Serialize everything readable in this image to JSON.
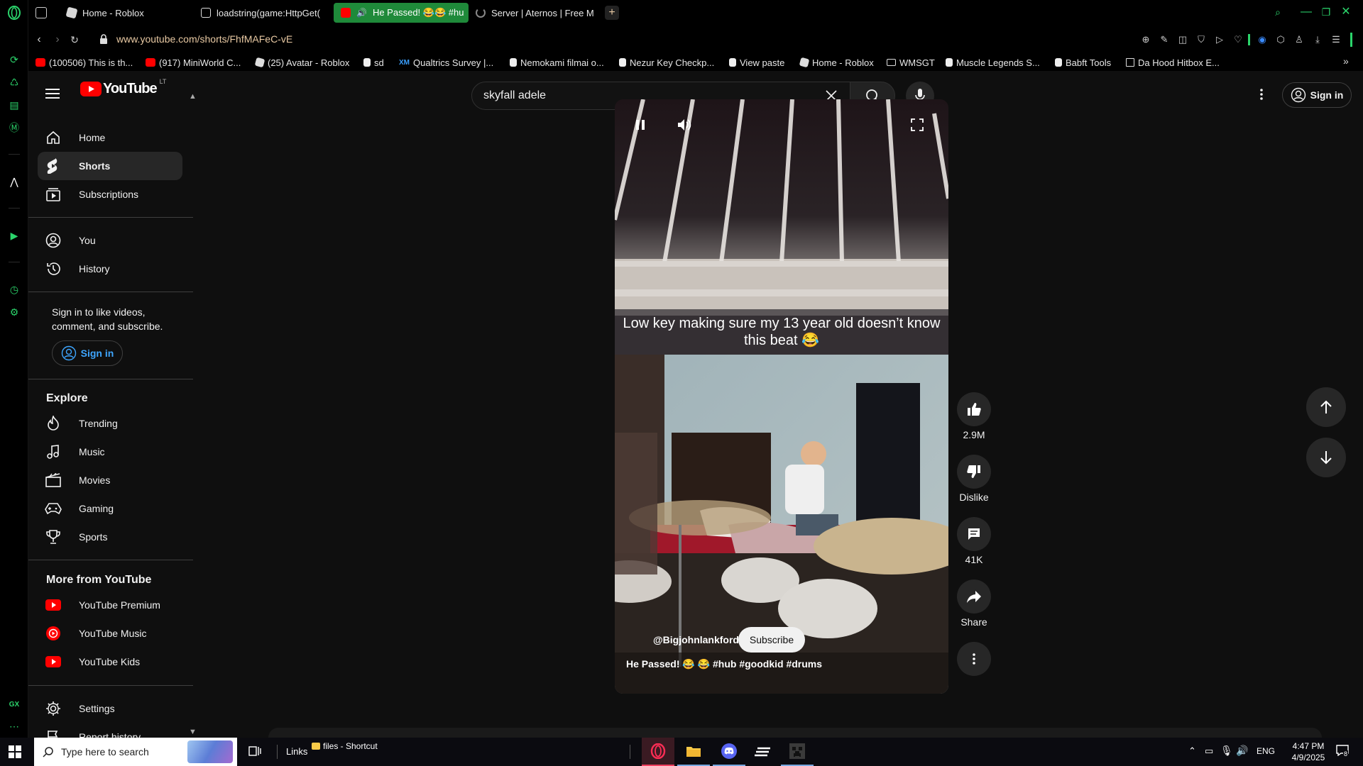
{
  "browser": {
    "tabs": [
      {
        "label": "Home - Roblox",
        "color": "#e0e0e0"
      },
      {
        "label": "loadstring(game:HttpGet(",
        "color": "#e0e0e0"
      },
      {
        "label": "He Passed! 😂😂 #hu",
        "color": "#ff0000"
      },
      {
        "label": "Server | Aternos | Free M",
        "color": "#888888"
      }
    ],
    "url": "www.youtube.com/shorts/FhfMAFeC-vE",
    "accent": "#2bd46b",
    "bookmarks": [
      {
        "label": "(100506) This is th...",
        "icon": "youtube"
      },
      {
        "label": "(917) MiniWorld C...",
        "icon": "youtube"
      },
      {
        "label": "(25) Avatar - Roblox",
        "icon": "roblox"
      },
      {
        "label": "sd",
        "icon": "page"
      },
      {
        "label": "Qualtrics Survey |...",
        "icon": "xm"
      },
      {
        "label": "Nemokami filmai o...",
        "icon": "page"
      },
      {
        "label": "Nezur Key Checkp...",
        "icon": "page"
      },
      {
        "label": "View paste",
        "icon": "page"
      },
      {
        "label": "Home - Roblox",
        "icon": "roblox"
      },
      {
        "label": "WMSGT",
        "icon": "folder"
      },
      {
        "label": "Muscle Legends S...",
        "icon": "page"
      },
      {
        "label": "Babft Tools",
        "icon": "page"
      },
      {
        "label": "Da Hood Hitbox E...",
        "icon": "grid"
      }
    ]
  },
  "youtube": {
    "logo_text": "YouTube",
    "country": "LT",
    "search_value": "skyfall adele",
    "signin_label": "Sign in",
    "guide": {
      "main": [
        {
          "label": "Home",
          "icon": "home-icon"
        },
        {
          "label": "Shorts",
          "icon": "shorts-icon"
        },
        {
          "label": "Subscriptions",
          "icon": "subscriptions-icon"
        }
      ],
      "you": [
        {
          "label": "You",
          "icon": "you-icon"
        },
        {
          "label": "History",
          "icon": "history-icon"
        }
      ],
      "signin_prompt": "Sign in to like videos, comment, and subscribe.",
      "signin_button": "Sign in",
      "explore_title": "Explore",
      "explore": [
        {
          "label": "Trending",
          "icon": "trending-icon"
        },
        {
          "label": "Music",
          "icon": "music-icon"
        },
        {
          "label": "Movies",
          "icon": "movies-icon"
        },
        {
          "label": "Gaming",
          "icon": "gaming-icon"
        },
        {
          "label": "Sports",
          "icon": "sports-icon"
        }
      ],
      "more_title": "More from YouTube",
      "more": [
        {
          "label": "YouTube Premium",
          "icon": "youtube-premium-icon"
        },
        {
          "label": "YouTube Music",
          "icon": "youtube-music-icon"
        },
        {
          "label": "YouTube Kids",
          "icon": "youtube-kids-icon"
        }
      ],
      "settings": "Settings",
      "report": "Report history"
    },
    "short": {
      "caption": "Low key making sure my 13 year old doesn’t know this beat 😂",
      "channel": "@Bigjohnlankford",
      "subscribe": "Subscribe",
      "title": "He Passed! 😂 😂 #hub #goodkid #drums",
      "likes": "2.9M",
      "dislike": "Dislike",
      "comments": "41K",
      "share": "Share"
    }
  },
  "taskbar": {
    "search_placeholder": "Type here to search",
    "links": "Links",
    "files": "files - Shortcut",
    "lang": "ENG",
    "time": "4:47 PM",
    "date": "4/9/2025",
    "notif": "8"
  }
}
